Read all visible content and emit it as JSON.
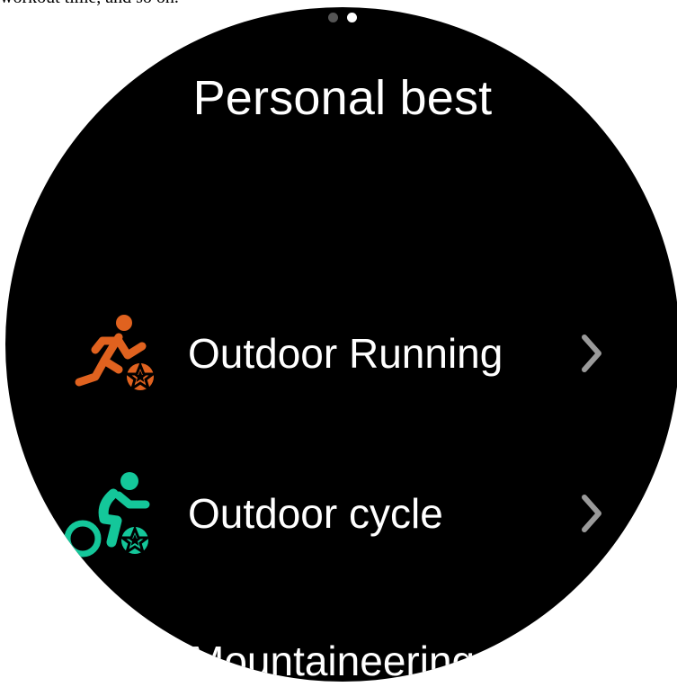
{
  "top_caption": "workout time, and so on.",
  "pager": {
    "count": 2,
    "active_index": 1
  },
  "title": "Personal best",
  "items": [
    {
      "label": "Outdoor Running",
      "icon": "running-icon",
      "color": "#E0621F"
    },
    {
      "label": "Outdoor cycle",
      "icon": "cycling-icon",
      "color": "#14C79A"
    },
    {
      "label": "Mountaineering",
      "icon": "mountaineering-icon",
      "color": "#E0621F"
    }
  ],
  "colors": {
    "background": "#000000",
    "text": "#FFFFFF",
    "chevron": "#9A9A9A",
    "dot_inactive": "#555555",
    "dot_active": "#FFFFFF"
  }
}
